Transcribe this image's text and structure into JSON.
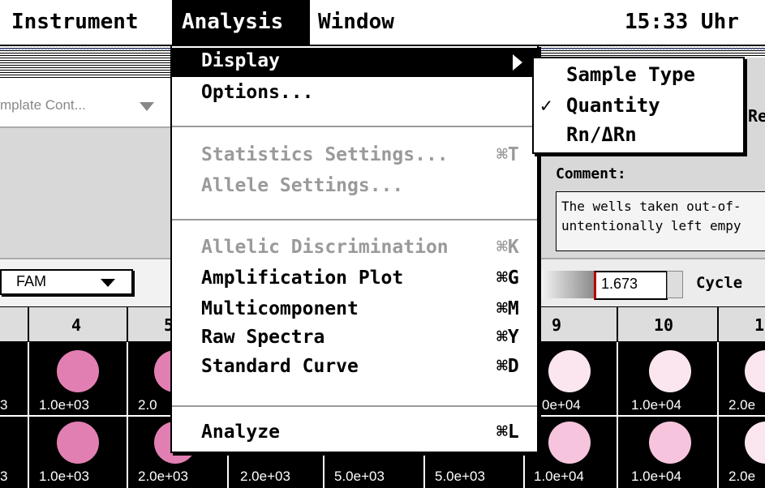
{
  "menubar": {
    "items": [
      "Instrument",
      "Analysis",
      "Window"
    ],
    "clock": "15:33 Uhr"
  },
  "toolbar": {
    "plate_select": "mplate Cont...",
    "dye_select": "FAM",
    "threshold_value": "1.673",
    "cycle_label": "Cycle",
    "re_label": "Re"
  },
  "comment": {
    "label": "Comment:",
    "text_line1": "The wells taken out-of-",
    "text_line2": "untentionally left empy"
  },
  "analysis_menu": {
    "items": [
      {
        "label": "Display",
        "shortcut": "",
        "enabled": true,
        "submenu": true
      },
      {
        "label": "Options...",
        "shortcut": "",
        "enabled": true
      },
      {
        "label": "Statistics Settings...",
        "shortcut": "⌘T",
        "enabled": false
      },
      {
        "label": "Allele Settings...",
        "shortcut": "",
        "enabled": false
      },
      {
        "label": "Allelic Discrimination",
        "shortcut": "⌘K",
        "enabled": false
      },
      {
        "label": "Amplification Plot",
        "shortcut": "⌘G",
        "enabled": true
      },
      {
        "label": "Multicomponent",
        "shortcut": "⌘M",
        "enabled": true
      },
      {
        "label": "Raw Spectra",
        "shortcut": "⌘Y",
        "enabled": true
      },
      {
        "label": "Standard Curve",
        "shortcut": "⌘D",
        "enabled": true
      },
      {
        "label": "Analyze",
        "shortcut": "⌘L",
        "enabled": true
      }
    ]
  },
  "display_submenu": {
    "items": [
      {
        "label": "Sample Type",
        "checked": false
      },
      {
        "label": "Quantity",
        "checked": true
      },
      {
        "label": "Rn/ΔRn",
        "checked": false
      }
    ],
    "check_mark": "✓"
  },
  "plate": {
    "columns": [
      "4",
      "5",
      "9",
      "10",
      "1"
    ],
    "row1_values": [
      "3",
      "1.0e+03",
      "2.0",
      "0e+04",
      "1.0e+04",
      "2.0e"
    ],
    "row2_values": [
      "3",
      "1.0e+03",
      "2.0e+03",
      "2.0e+03",
      "5.0e+03",
      "5.0e+03",
      "1.0e+04",
      "1.0e+04",
      "2.0e"
    ],
    "colors": {
      "dark_pink": "#e27fb2",
      "light_pink": "#f6c4dc",
      "pale": "#fbe6f0"
    }
  }
}
